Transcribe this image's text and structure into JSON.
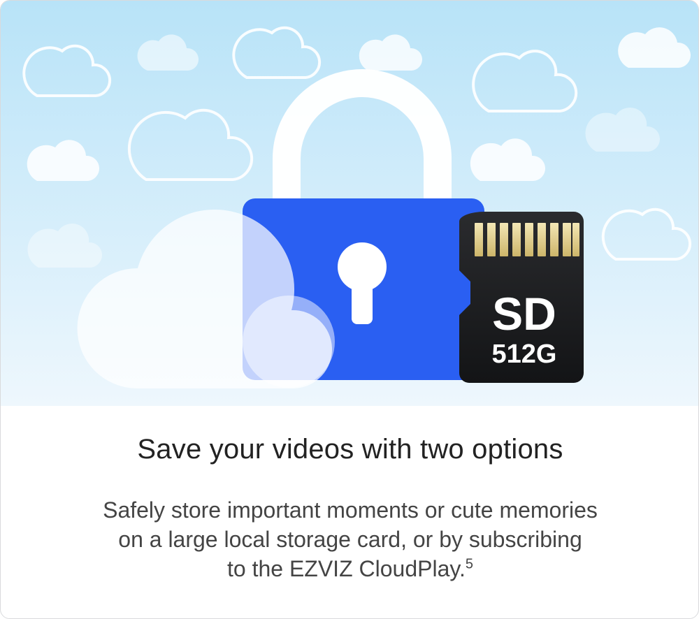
{
  "hero": {
    "sd_card": {
      "label_main": "SD",
      "label_capacity": "512G"
    },
    "colors": {
      "sky_top": "#b8e3f8",
      "sky_bottom": "#eef7fd",
      "lock_body": "#2a5ff2",
      "sd_card_body": "#1b1c1e",
      "contacts": "#e6d394"
    }
  },
  "caption": {
    "title": "Save your videos with two options",
    "description_lines": [
      "Safely store important moments or cute memories",
      "on a large local storage card, or by subscribing",
      "to the EZVIZ CloudPlay."
    ],
    "footnote_marker": "5"
  }
}
